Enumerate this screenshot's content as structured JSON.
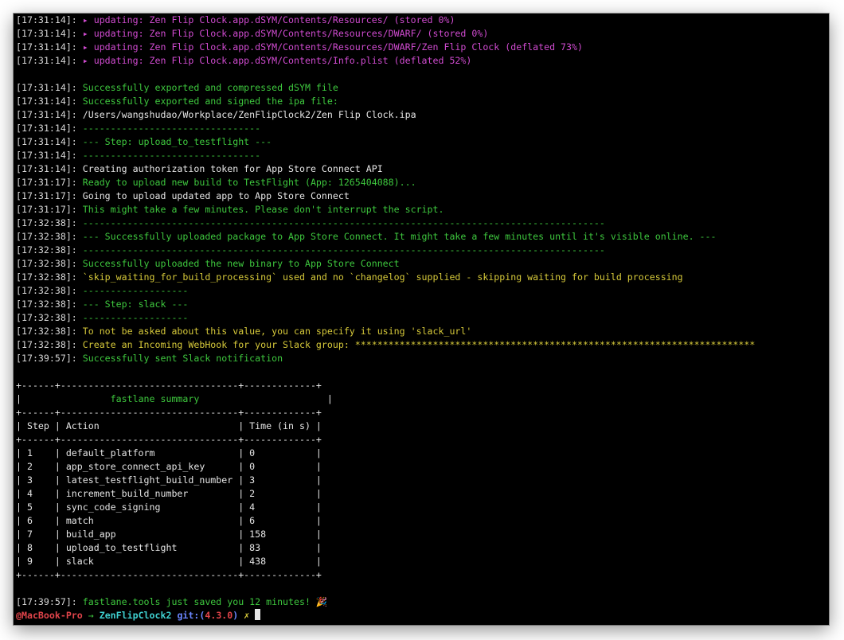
{
  "terminal": {
    "log": [
      {
        "ts": "[17:31:14]: ",
        "text": "▸ updating: Zen Flip Clock.app.dSYM/Contents/Resources/ (stored 0%)",
        "color": "magenta"
      },
      {
        "ts": "[17:31:14]: ",
        "text": "▸ updating: Zen Flip Clock.app.dSYM/Contents/Resources/DWARF/ (stored 0%)",
        "color": "magenta"
      },
      {
        "ts": "[17:31:14]: ",
        "text": "▸ updating: Zen Flip Clock.app.dSYM/Contents/Resources/DWARF/Zen Flip Clock (deflated 73%)",
        "color": "magenta"
      },
      {
        "ts": "[17:31:14]: ",
        "text": "▸ updating: Zen Flip Clock.app.dSYM/Contents/Info.plist (deflated 52%)",
        "color": "magenta"
      },
      {
        "ts": "",
        "text": "",
        "color": "default"
      },
      {
        "ts": "[17:31:14]: ",
        "text": "Successfully exported and compressed dSYM file",
        "color": "green"
      },
      {
        "ts": "[17:31:14]: ",
        "text": "Successfully exported and signed the ipa file:",
        "color": "green"
      },
      {
        "ts": "[17:31:14]: ",
        "text": "/Users/wangshudao/Workplace/ZenFlipClock2/Zen Flip Clock.ipa",
        "color": "white"
      },
      {
        "ts": "[17:31:14]: ",
        "text": "--------------------------------",
        "color": "green"
      },
      {
        "ts": "[17:31:14]: ",
        "text": "--- Step: upload_to_testflight ---",
        "color": "green"
      },
      {
        "ts": "[17:31:14]: ",
        "text": "--------------------------------",
        "color": "green"
      },
      {
        "ts": "[17:31:14]: ",
        "text": "Creating authorization token for App Store Connect API",
        "color": "white"
      },
      {
        "ts": "[17:31:17]: ",
        "text": "Ready to upload new build to TestFlight (App: 1265404088)...",
        "color": "green"
      },
      {
        "ts": "[17:31:17]: ",
        "text": "Going to upload updated app to App Store Connect",
        "color": "white"
      },
      {
        "ts": "[17:31:17]: ",
        "text": "This might take a few minutes. Please don't interrupt the script.",
        "color": "green"
      },
      {
        "ts": "[17:32:38]: ",
        "text": "----------------------------------------------------------------------------------------------",
        "color": "green"
      },
      {
        "ts": "[17:32:38]: ",
        "text": "--- Successfully uploaded package to App Store Connect. It might take a few minutes until it's visible online. ---",
        "color": "green"
      },
      {
        "ts": "[17:32:38]: ",
        "text": "----------------------------------------------------------------------------------------------",
        "color": "green"
      },
      {
        "ts": "[17:32:38]: ",
        "text": "Successfully uploaded the new binary to App Store Connect",
        "color": "green"
      },
      {
        "ts": "[17:32:38]: ",
        "text": "`skip_waiting_for_build_processing` used and no `changelog` supplied - skipping waiting for build processing",
        "color": "yellow"
      },
      {
        "ts": "[17:32:38]: ",
        "text": "-------------------",
        "color": "green"
      },
      {
        "ts": "[17:32:38]: ",
        "text": "--- Step: slack ---",
        "color": "green"
      },
      {
        "ts": "[17:32:38]: ",
        "text": "-------------------",
        "color": "green"
      },
      {
        "ts": "[17:32:38]: ",
        "text": "To not be asked about this value, you can specify it using 'slack_url'",
        "color": "yellow"
      },
      {
        "ts": "[17:32:38]: ",
        "text": "Create an Incoming WebHook for your Slack group: ************************************************************************",
        "color": "yellow"
      },
      {
        "ts": "[17:39:57]: ",
        "text": "Successfully sent Slack notification",
        "color": "green"
      },
      {
        "ts": "",
        "text": "",
        "color": "default"
      }
    ],
    "summary": [
      "+------+--------------------------------+-------------+",
      "|                fastlane summary                       |",
      "+------+--------------------------------+-------------+",
      "| Step | Action                         | Time (in s) |",
      "+------+--------------------------------+-------------+",
      "| 1    | default_platform               | 0           |",
      "| 2    | app_store_connect_api_key      | 0           |",
      "| 3    | latest_testflight_build_number | 3           |",
      "| 4    | increment_build_number         | 2           |",
      "| 5    | sync_code_signing              | 4           |",
      "| 6    | match                          | 6           |",
      "| 7    | build_app                      | 158         |",
      "| 8    | upload_to_testflight           | 83          |",
      "| 9    | slack                          | 438         |",
      "+------+--------------------------------+-------------+"
    ],
    "summary_title": "fastlane summary",
    "footer": {
      "ts": "[17:39:57]: ",
      "text": "fastlane.tools just saved you 12 minutes! 🎉"
    },
    "prompt": {
      "host": "@MacBook-Pro",
      "arrow": "→",
      "dir": "ZenFlipClock2",
      "git_label": "git:",
      "branch_open": "(",
      "branch": "4.3.0",
      "branch_close": ")",
      "dirty": "✗"
    }
  },
  "colors": {
    "background": "#000000",
    "green": "#3ec83e",
    "magenta": "#d04bd0",
    "yellow": "#d6c93a",
    "white": "#e6e6e6"
  }
}
